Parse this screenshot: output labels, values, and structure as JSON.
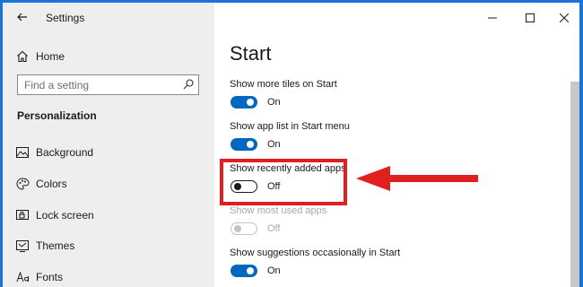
{
  "window": {
    "title": "Settings"
  },
  "sidebar": {
    "home_label": "Home",
    "search_placeholder": "Find a setting",
    "section": "Personalization",
    "items": [
      {
        "label": "Background",
        "icon": "image-icon"
      },
      {
        "label": "Colors",
        "icon": "palette-icon"
      },
      {
        "label": "Lock screen",
        "icon": "lock-screen-icon"
      },
      {
        "label": "Themes",
        "icon": "themes-icon"
      },
      {
        "label": "Fonts",
        "icon": "fonts-icon"
      }
    ]
  },
  "main": {
    "title": "Start",
    "settings": [
      {
        "label": "Show more tiles on Start",
        "state": "On",
        "on": true,
        "disabled": false
      },
      {
        "label": "Show app list in Start menu",
        "state": "On",
        "on": true,
        "disabled": false
      },
      {
        "label": "Show recently added apps",
        "state": "Off",
        "on": false,
        "disabled": false
      },
      {
        "label": "Show most used apps",
        "state": "Off",
        "on": false,
        "disabled": true
      },
      {
        "label": "Show suggestions occasionally in Start",
        "state": "On",
        "on": true,
        "disabled": false
      }
    ]
  },
  "colors": {
    "accent": "#0067c0",
    "highlight": "#e02020",
    "desktop": "#1a73d6"
  }
}
